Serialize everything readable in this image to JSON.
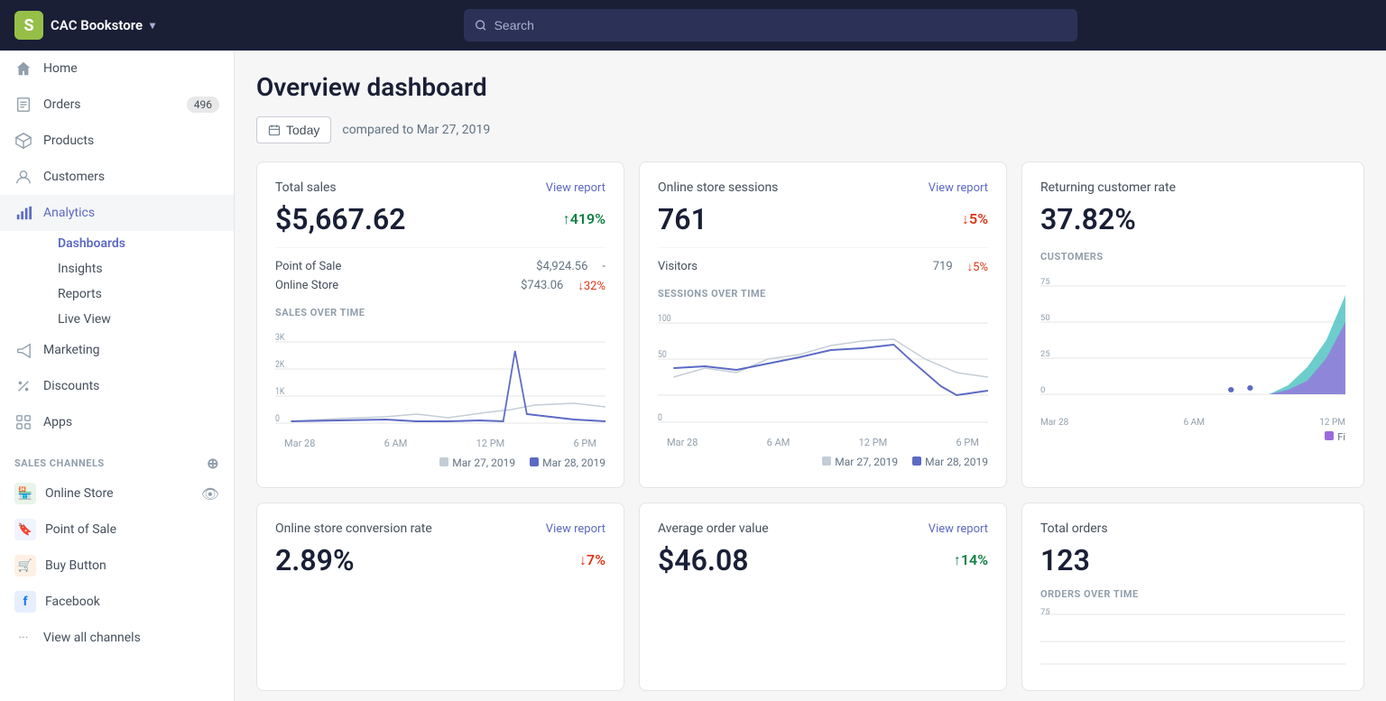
{
  "topbar": {
    "brand": "CAC Bookstore",
    "search_placeholder": "Search",
    "chevron": "▾"
  },
  "sidebar": {
    "nav_items": [
      {
        "id": "home",
        "label": "Home",
        "icon": "home"
      },
      {
        "id": "orders",
        "label": "Orders",
        "icon": "orders",
        "badge": "496"
      },
      {
        "id": "products",
        "label": "Products",
        "icon": "products"
      },
      {
        "id": "customers",
        "label": "Customers",
        "icon": "customers"
      },
      {
        "id": "analytics",
        "label": "Analytics",
        "icon": "analytics",
        "active": true
      }
    ],
    "analytics_sub": [
      {
        "id": "dashboards",
        "label": "Dashboards",
        "active": true
      },
      {
        "id": "insights",
        "label": "Insights"
      },
      {
        "id": "reports",
        "label": "Reports"
      },
      {
        "id": "live-view",
        "label": "Live View"
      }
    ],
    "more_items": [
      {
        "id": "marketing",
        "label": "Marketing",
        "icon": "marketing"
      },
      {
        "id": "discounts",
        "label": "Discounts",
        "icon": "discounts"
      },
      {
        "id": "apps",
        "label": "Apps",
        "icon": "apps"
      }
    ],
    "sales_channels_header": "SALES CHANNELS",
    "channels": [
      {
        "id": "online-store",
        "label": "Online Store",
        "type": "store"
      },
      {
        "id": "point-of-sale",
        "label": "Point of Sale",
        "type": "pos"
      },
      {
        "id": "buy-button",
        "label": "Buy Button",
        "type": "buy"
      },
      {
        "id": "facebook",
        "label": "Facebook",
        "type": "fb"
      }
    ],
    "view_all_channels": "View all channels"
  },
  "dashboard": {
    "title": "Overview dashboard",
    "date_button": "Today",
    "compared_text": "compared to Mar 27, 2019",
    "cards": {
      "total_sales": {
        "title": "Total sales",
        "view_report": "View report",
        "value": "$5,667.62",
        "change": "↑419%",
        "change_type": "up",
        "sub_rows": [
          {
            "label": "Point of Sale",
            "value": "$4,924.56",
            "change": "-"
          },
          {
            "label": "Online Store",
            "value": "$743.06",
            "change": "↓32%",
            "change_type": "down"
          }
        ],
        "chart_label": "SALES OVER TIME",
        "legend": [
          "Mar 27, 2019",
          "Mar 28, 2019"
        ]
      },
      "online_sessions": {
        "title": "Online store sessions",
        "view_report": "View report",
        "value": "761",
        "change": "↓5%",
        "change_type": "down",
        "visitors_label": "Visitors",
        "visitors_value": "719",
        "visitors_change": "↓5%",
        "visitors_change_type": "down",
        "chart_label": "SESSIONS OVER TIME",
        "legend": [
          "Mar 27, 2019",
          "Mar 28, 2019"
        ]
      },
      "returning_customer": {
        "title": "Returning customer rate",
        "value": "37.82%",
        "customers_label": "CUSTOMERS",
        "legend_label": "Fi"
      },
      "avg_order": {
        "title": "Average order value",
        "view_report": "View report",
        "value": "$46.08",
        "change": "↑14%",
        "change_type": "up"
      },
      "conversion_rate": {
        "title": "Online store conversion rate",
        "view_report": "View report",
        "value": "2.89%",
        "change": "↓7%",
        "change_type": "down"
      },
      "total_orders": {
        "title": "Total orders",
        "value": "123",
        "orders_label": "ORDERS OVER TIME"
      }
    }
  }
}
